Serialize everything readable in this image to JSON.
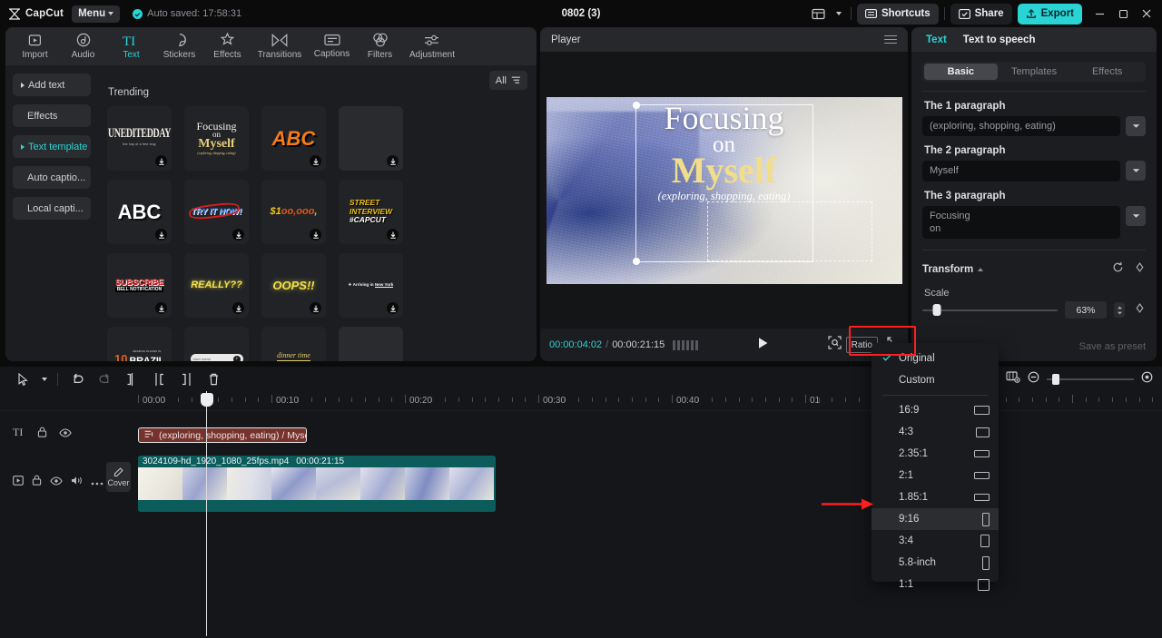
{
  "titlebar": {
    "brand": "CapCut",
    "menu_label": "Menu",
    "autosave": "Auto saved: 17:58:31",
    "project_title": "0802 (3)",
    "shortcuts_label": "Shortcuts",
    "share_label": "Share",
    "export_label": "Export",
    "layout_icon": "layout-icon",
    "minimize_icon": "minimize-icon",
    "maximize_icon": "maximize-icon",
    "close_icon": "close-icon",
    "accent": "#2ad4d4"
  },
  "toolbar_tabs": [
    {
      "label": "Import",
      "icon": "import-icon",
      "active": false
    },
    {
      "label": "Audio",
      "icon": "audio-icon",
      "active": false
    },
    {
      "label": "Text",
      "icon": "text-icon",
      "active": true
    },
    {
      "label": "Stickers",
      "icon": "stickers-icon",
      "active": false
    },
    {
      "label": "Effects",
      "icon": "effects-icon",
      "active": false
    },
    {
      "label": "Transitions",
      "icon": "transitions-icon",
      "active": false
    },
    {
      "label": "Captions",
      "icon": "captions-icon",
      "active": false
    },
    {
      "label": "Filters",
      "icon": "filters-icon",
      "active": false
    },
    {
      "label": "Adjustment",
      "icon": "adjustment-icon",
      "active": false
    }
  ],
  "left_sidebar": {
    "items": [
      {
        "label": "Add text",
        "caret": true,
        "active": false
      },
      {
        "label": "Effects",
        "caret": false,
        "active": false
      },
      {
        "label": "Text template",
        "caret": true,
        "active": true
      },
      {
        "label": "Auto captio...",
        "caret": false,
        "active": false
      },
      {
        "label": "Local capti...",
        "caret": false,
        "active": false
      }
    ]
  },
  "template_browser": {
    "filter_label": "All",
    "filter_icon": "filter-icon",
    "section_title": "Trending",
    "download_icon": "download-icon",
    "items": [
      {
        "preview_text": "UNEDITEDDAY",
        "sub_text": "the hop of a free vlog",
        "style": "condensed-serif-white",
        "download": true
      },
      {
        "preview_text": "Focusing on Myself",
        "sub_text": "(exploring, shopping, eating)",
        "style": "focusing-serif",
        "download": false
      },
      {
        "preview_text": "ABC",
        "style": "abc-orange",
        "download": true
      },
      {
        "preview_text": "",
        "style": "empty",
        "download": true
      },
      {
        "preview_text": "ABC",
        "style": "abc-white",
        "download": true
      },
      {
        "preview_text": "TRY IT NOW!",
        "style": "try-it-now",
        "download": true
      },
      {
        "preview_text": "$100,000",
        "style": "money",
        "download": true
      },
      {
        "preview_text": "STREET INTERVIEW #CAPCUT",
        "style": "street-interview",
        "download": true
      },
      {
        "preview_text": "SUBSCRIBE BELL NOTIFICATION",
        "style": "subscribe",
        "download": true
      },
      {
        "preview_text": "REALLY??",
        "style": "really",
        "download": true
      },
      {
        "preview_text": "OOPS!!",
        "style": "oops",
        "download": true
      },
      {
        "preview_text": "Arriving in New York",
        "style": "arriving",
        "download": true
      },
      {
        "preview_text": "10 BRAZIL",
        "style": "brazil",
        "download": true
      },
      {
        "preview_text": "User name",
        "style": "username-bar",
        "download": true
      },
      {
        "preview_text": "dinner time",
        "sub_text": "Solse*",
        "style": "dinner-time",
        "download": true
      },
      {
        "preview_text": "",
        "style": "empty",
        "download": false
      },
      {
        "preview_text": "",
        "style": "empty",
        "download": false
      },
      {
        "preview_text": "",
        "style": "empty",
        "download": false
      },
      {
        "preview_text": "",
        "style": "empty",
        "download": false
      },
      {
        "preview_text": "",
        "style": "empty",
        "download": false
      }
    ]
  },
  "player": {
    "title": "Player",
    "menu_icon": "hamburger-icon",
    "overlay": {
      "line1": "Focusing",
      "line2": "on",
      "line3": "Myself",
      "line4": "(exploring, shopping, eating)",
      "line3_color": "#f2dd8a"
    },
    "current_time": "00:00:04:02",
    "separator": "/",
    "total_time": "00:00:21:15",
    "play_icon": "play-icon",
    "frames_icon": "frames-icon",
    "fit_icon": "fit-to-screen-icon",
    "ratio_button": "Ratio",
    "fullscreen_icon": "fullscreen-icon",
    "rotate_icon": "rotate-handle-icon"
  },
  "ratio_menu": {
    "items": [
      {
        "label": "Original",
        "shape": null,
        "checked": true,
        "highlighted": false
      },
      {
        "label": "Custom",
        "shape": null,
        "checked": false,
        "highlighted": false
      },
      {
        "label": "16:9",
        "shape": "landscape-wide",
        "checked": false,
        "highlighted": false
      },
      {
        "label": "4:3",
        "shape": "landscape",
        "checked": false,
        "highlighted": false
      },
      {
        "label": "2.35:1",
        "shape": "ultrawide",
        "checked": false,
        "highlighted": false
      },
      {
        "label": "2:1",
        "shape": "ultrawide",
        "checked": false,
        "highlighted": false
      },
      {
        "label": "1.85:1",
        "shape": "ultrawide",
        "checked": false,
        "highlighted": false
      },
      {
        "label": "9:16",
        "shape": "portrait-tall",
        "checked": false,
        "highlighted": true
      },
      {
        "label": "3:4",
        "shape": "portrait",
        "checked": false,
        "highlighted": false
      },
      {
        "label": "5.8-inch",
        "shape": "portrait-tall",
        "checked": false,
        "highlighted": false
      },
      {
        "label": "1:1",
        "shape": "square",
        "checked": false,
        "highlighted": false
      }
    ],
    "highlight_color": "#ff1e1e"
  },
  "right_panel": {
    "tabs": [
      {
        "label": "Text",
        "active": true
      },
      {
        "label": "Text to speech",
        "active": false
      }
    ],
    "segments": [
      {
        "label": "Basic",
        "active": true
      },
      {
        "label": "Templates",
        "active": false
      },
      {
        "label": "Effects",
        "active": false
      }
    ],
    "paragraphs": [
      {
        "label": "The 1 paragraph",
        "value": "(exploring, shopping, eating)",
        "tall": false
      },
      {
        "label": "The 2 paragraph",
        "value": "Myself",
        "tall": false
      },
      {
        "label": "The 3 paragraph",
        "value": "Focusing\non",
        "tall": true
      }
    ],
    "transform": {
      "title": "Transform",
      "reset_icon": "reset-icon",
      "keyframe_icon": "keyframe-icon",
      "scale_label": "Scale",
      "scale_value": "63%",
      "stepper_icon": "stepper-icon"
    },
    "save_preset": "Save as preset"
  },
  "timeline": {
    "tools": [
      {
        "name": "select-tool",
        "icon": "cursor-icon"
      },
      {
        "name": "tool-dropdown",
        "icon": "chevron-down-icon"
      },
      {
        "name": "undo",
        "icon": "undo-icon"
      },
      {
        "name": "redo",
        "icon": "redo-icon"
      },
      {
        "name": "split",
        "icon": "split-icon"
      },
      {
        "name": "trim-left",
        "icon": "trim-left-icon"
      },
      {
        "name": "trim-right",
        "icon": "trim-right-icon"
      },
      {
        "name": "delete",
        "icon": "trash-icon"
      }
    ],
    "mic_icon": "microphone-icon",
    "right_tools": [
      {
        "name": "fit-timeline",
        "icon": "fit-timeline-icon"
      },
      {
        "name": "zoom-out",
        "icon": "zoom-out-icon"
      },
      {
        "name": "zoom-in",
        "icon": "zoom-in-icon"
      }
    ],
    "ruler_labels": [
      "00:00",
      "00:10",
      "00:20",
      "00:30",
      "00:40",
      "01"
    ],
    "text_track": {
      "icon": "text-track-icon",
      "lock_icon": "lock-icon",
      "eye_icon": "eye-icon",
      "clip_icon": "text-clip-icon",
      "clip_label": "(exploring, shopping, eating) / Myself"
    },
    "video_track": {
      "icon": "video-track-icon",
      "lock_icon": "lock-icon",
      "eye_icon": "eye-icon",
      "volume_icon": "volume-icon",
      "more_icon": "more-icon",
      "cover_label": "Cover",
      "cover_icon": "pencil-icon",
      "clip_name": "3024109-hd_1920_1080_25fps.mp4",
      "clip_duration": "00:00:21:15"
    }
  }
}
